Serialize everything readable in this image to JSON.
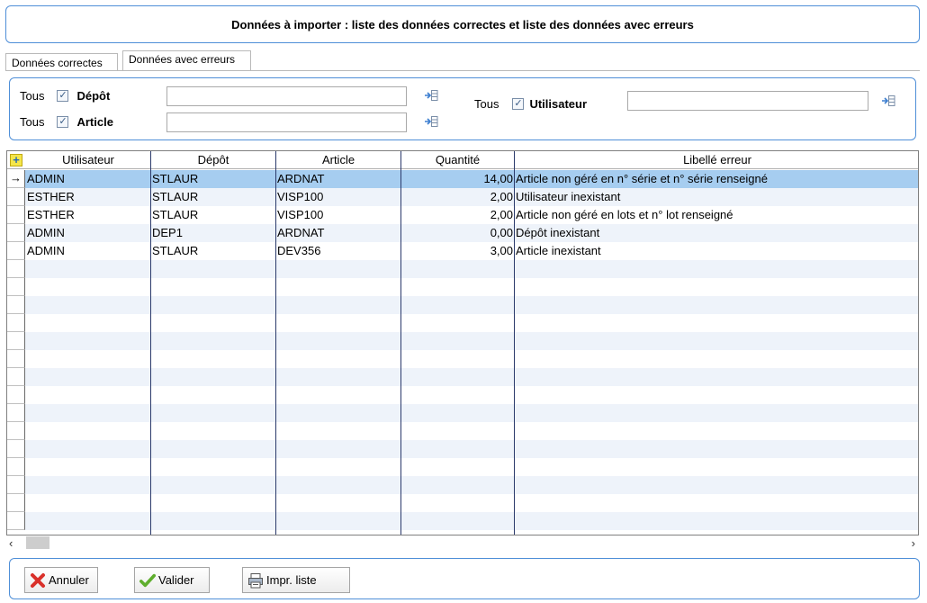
{
  "header": {
    "title": "Données à importer : liste des données correctes et liste des données avec erreurs"
  },
  "tabs": [
    {
      "label": "Données correctes",
      "active": false
    },
    {
      "label": "Données avec erreurs",
      "active": true
    }
  ],
  "filters": {
    "depot": {
      "tous_label": "Tous",
      "label": "Dépôt",
      "checked": true,
      "value": ""
    },
    "article": {
      "tous_label": "Tous",
      "label": "Article",
      "checked": true,
      "value": ""
    },
    "utilisateur": {
      "tous_label": "Tous",
      "label": "Utilisateur",
      "checked": true,
      "value": ""
    }
  },
  "table": {
    "columns": [
      "Utilisateur",
      "Dépôt",
      "Article",
      "Quantité",
      "Libellé erreur"
    ],
    "rows": [
      {
        "utilisateur": "ADMIN",
        "depot": "STLAUR",
        "article": "ARDNAT",
        "quantite": "14,00",
        "erreur": "Article non géré en n° série et n° série renseigné"
      },
      {
        "utilisateur": "ESTHER",
        "depot": "STLAUR",
        "article": "VISP100",
        "quantite": "2,00",
        "erreur": "Utilisateur inexistant"
      },
      {
        "utilisateur": "ESTHER",
        "depot": "STLAUR",
        "article": "VISP100",
        "quantite": "2,00",
        "erreur": "Article non géré en lots et n° lot renseigné"
      },
      {
        "utilisateur": "ADMIN",
        "depot": "DEP1",
        "article": "ARDNAT",
        "quantite": "0,00",
        "erreur": "Dépôt inexistant"
      },
      {
        "utilisateur": "ADMIN",
        "depot": "STLAUR",
        "article": "DEV356",
        "quantite": "3,00",
        "erreur": "Article inexistant"
      }
    ],
    "selected_row": 0
  },
  "icons": {
    "row_pointer": "→",
    "scroll_left": "‹",
    "scroll_right": "›",
    "check": "✓"
  },
  "buttons": {
    "annuler": "Annuler",
    "valider": "Valider",
    "imprimer": "Impr. liste"
  }
}
